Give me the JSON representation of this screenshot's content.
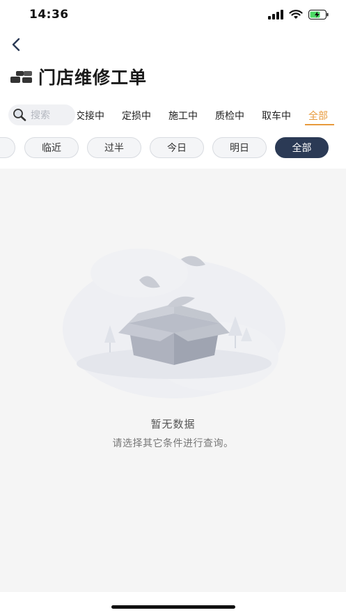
{
  "status_bar": {
    "time": "14:36"
  },
  "header": {
    "title": "门店维修工单"
  },
  "search": {
    "placeholder": "搜索"
  },
  "tabs": [
    {
      "label": "交接中"
    },
    {
      "label": "定损中"
    },
    {
      "label": "施工中"
    },
    {
      "label": "质检中"
    },
    {
      "label": "取车中"
    },
    {
      "label": "全部",
      "active": true
    }
  ],
  "filters": [
    {
      "label": "临近"
    },
    {
      "label": "过半"
    },
    {
      "label": "今日"
    },
    {
      "label": "明日"
    },
    {
      "label": "全部",
      "active": true
    }
  ],
  "empty_state": {
    "title": "暂无数据",
    "subtitle": "请选择其它条件进行查询。"
  },
  "colors": {
    "accent": "#e89a3c",
    "chip_active": "#2b3a55",
    "content_bg": "#f5f5f5"
  }
}
